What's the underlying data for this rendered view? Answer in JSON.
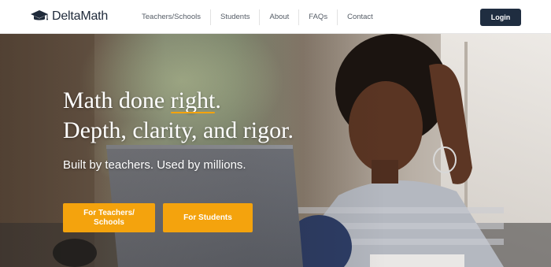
{
  "header": {
    "logo_text": "DeltaMath",
    "logo_icon": "graduation-cap-icon",
    "nav": [
      {
        "label": "Teachers/Schools"
      },
      {
        "label": "Students"
      },
      {
        "label": "About"
      },
      {
        "label": "FAQs"
      },
      {
        "label": "Contact"
      }
    ],
    "login_label": "Login"
  },
  "hero": {
    "title_prefix": "Math done ",
    "title_emphasis": "right",
    "title_suffix": ".",
    "title_line2": "Depth, clarity, and rigor.",
    "subtitle": "Built by teachers. Used by millions.",
    "cta_teachers": "For Teachers/ Schools",
    "cta_students": "For Students"
  },
  "colors": {
    "accent": "#f4a30d",
    "nav_dark": "#1f2d40",
    "text_dark": "#1f2a3a"
  }
}
